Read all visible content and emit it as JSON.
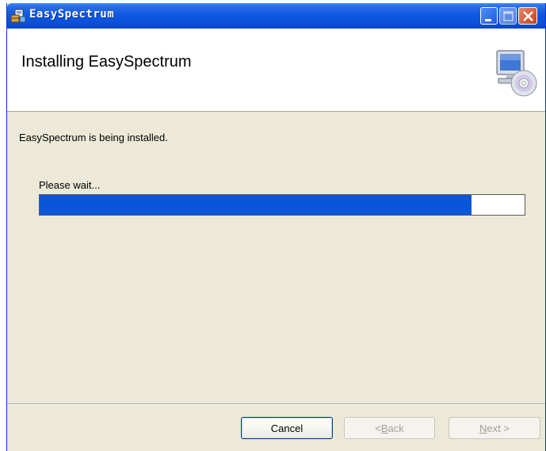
{
  "window": {
    "title": "EasySpectrum"
  },
  "header": {
    "title": "Installing EasySpectrum"
  },
  "body": {
    "status_text": "EasySpectrum is being installed.",
    "wait_text": "Please wait...",
    "progress_fraction": 0.89
  },
  "buttons": {
    "cancel": "Cancel",
    "back_prefix": "< ",
    "back_mnemonic": "B",
    "back_rest": "ack",
    "next_mnemonic": "N",
    "next_rest": "ext >"
  },
  "icons": {
    "app": "installer-icon",
    "header": "computer-cd-icon",
    "minimize": "minimize-icon",
    "maximize": "maximize-icon",
    "close": "close-icon"
  },
  "colors": {
    "titlebar": "#0b4fd8",
    "progress_fill": "#0a56d8",
    "dialog_background": "#ece9d8"
  }
}
